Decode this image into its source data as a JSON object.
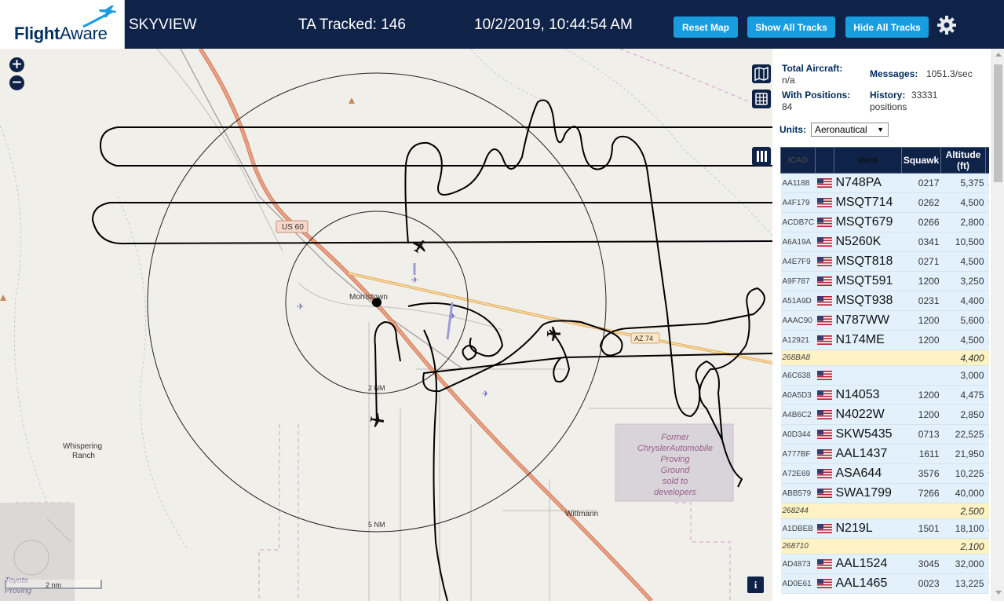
{
  "header": {
    "logo_brand": "Flight",
    "logo_brand2": "Aware",
    "site_name": "SKYVIEW",
    "tracked_label": "TA Tracked: 146",
    "clock": "10/2/2019, 10:44:54 AM",
    "buttons": {
      "reset": "Reset Map",
      "show": "Show All Tracks",
      "hide": "Hide All Tracks"
    },
    "settings_icon": "gear-icon",
    "accent": "#189ee0",
    "bar_color": "#0f2248"
  },
  "map": {
    "zoom_in": "+",
    "zoom_out": "−",
    "labels": {
      "road_us60": "US 60",
      "road_az74": "AZ 74",
      "town1": "Morristown",
      "town2": "Wittmann",
      "ranch_l1": "Whispering",
      "ranch_l2": "Ranch",
      "ring_2": "2 NM",
      "ring_5": "5 NM",
      "former_l1": "Former",
      "former_l2": "ChryslerAutomobile",
      "former_l3": "Proving",
      "former_l4": "Ground",
      "former_l5": "sold to",
      "former_l6": "developers",
      "toyota_l1": "Toyota",
      "toyota_l2": "Proving"
    },
    "scale_label": "2 nm",
    "info": "i",
    "icons": [
      "layers-icon",
      "grid-icon",
      "sidebar-toggle-icon"
    ]
  },
  "stats": {
    "total_label": "Total Aircraft:",
    "total_value": "n/a",
    "messages_label": "Messages:",
    "messages_value": "1051.3/sec",
    "positions_label": "With Positions:",
    "positions_value": "84",
    "history_label": "History:",
    "history_value": "33331",
    "history_unit": "positions",
    "units_label": "Units:",
    "units_value": "Aeronautical"
  },
  "table": {
    "headers": {
      "icao": "ICAO",
      "ident": "Ident",
      "squawk": "Squawk",
      "alt1": "Altitude",
      "alt2": "(ft)"
    },
    "rows": [
      {
        "icao": "AA1188",
        "flag": true,
        "ident": "N748PA",
        "squawk": "0217",
        "alt": "5,375",
        "trend": "▲",
        "mlat": false
      },
      {
        "icao": "A4F179",
        "flag": true,
        "ident": "MSQT714",
        "squawk": "0262",
        "alt": "4,500",
        "trend": "▼",
        "mlat": false
      },
      {
        "icao": "ACDB7C",
        "flag": true,
        "ident": "MSQT679",
        "squawk": "0266",
        "alt": "2,800",
        "trend": "▲",
        "mlat": false
      },
      {
        "icao": "A6A19A",
        "flag": true,
        "ident": "N5260K",
        "squawk": "0341",
        "alt": "10,500",
        "trend": "",
        "mlat": false
      },
      {
        "icao": "A4E7F9",
        "flag": true,
        "ident": "MSQT818",
        "squawk": "0271",
        "alt": "4,500",
        "trend": "",
        "mlat": false
      },
      {
        "icao": "A9F787",
        "flag": true,
        "ident": "MSQT591",
        "squawk": "1200",
        "alt": "3,250",
        "trend": "",
        "mlat": false
      },
      {
        "icao": "A51A9D",
        "flag": true,
        "ident": "MSQT938",
        "squawk": "0231",
        "alt": "4,400",
        "trend": "▲",
        "mlat": false
      },
      {
        "icao": "AAAC90",
        "flag": true,
        "ident": "N787WW",
        "squawk": "1200",
        "alt": "5,600",
        "trend": "▲",
        "mlat": false
      },
      {
        "icao": "A12921",
        "flag": true,
        "ident": "N174ME",
        "squawk": "1200",
        "alt": "4,500",
        "trend": "▲",
        "mlat": false
      },
      {
        "icao": "268BA8",
        "flag": false,
        "ident": "",
        "squawk": "",
        "alt": "4,400",
        "trend": "",
        "mlat": true
      },
      {
        "icao": "A6C638",
        "flag": true,
        "ident": "",
        "squawk": "",
        "alt": "3,000",
        "trend": "",
        "mlat": false
      },
      {
        "icao": "A0A5D3",
        "flag": true,
        "ident": "N14053",
        "squawk": "1200",
        "alt": "4,475",
        "trend": "",
        "mlat": false
      },
      {
        "icao": "A4B6C2",
        "flag": true,
        "ident": "N4022W",
        "squawk": "1200",
        "alt": "2,850",
        "trend": "",
        "mlat": false
      },
      {
        "icao": "A0D344",
        "flag": true,
        "ident": "SKW5435",
        "squawk": "0713",
        "alt": "22,525",
        "trend": "▲",
        "mlat": false
      },
      {
        "icao": "A777BF",
        "flag": true,
        "ident": "AAL1437",
        "squawk": "1611",
        "alt": "21,950",
        "trend": "▲",
        "mlat": false
      },
      {
        "icao": "A72E69",
        "flag": true,
        "ident": "ASA644",
        "squawk": "3576",
        "alt": "10,225",
        "trend": "▼",
        "mlat": false
      },
      {
        "icao": "ABB579",
        "flag": true,
        "ident": "SWA1799",
        "squawk": "7266",
        "alt": "40,000",
        "trend": "",
        "mlat": false
      },
      {
        "icao": "268244",
        "flag": false,
        "ident": "",
        "squawk": "",
        "alt": "2,500",
        "trend": "",
        "mlat": true
      },
      {
        "icao": "A1DBEB",
        "flag": true,
        "ident": "N219L",
        "squawk": "1501",
        "alt": "18,100",
        "trend": "▲",
        "mlat": false
      },
      {
        "icao": "268710",
        "flag": false,
        "ident": "",
        "squawk": "",
        "alt": "2,100",
        "trend": "",
        "mlat": true
      },
      {
        "icao": "AD4873",
        "flag": true,
        "ident": "AAL1524",
        "squawk": "3045",
        "alt": "32,000",
        "trend": "",
        "mlat": false
      },
      {
        "icao": "AD0E61",
        "flag": true,
        "ident": "AAL1465",
        "squawk": "0023",
        "alt": "13,225",
        "trend": "▼",
        "mlat": false
      }
    ]
  }
}
